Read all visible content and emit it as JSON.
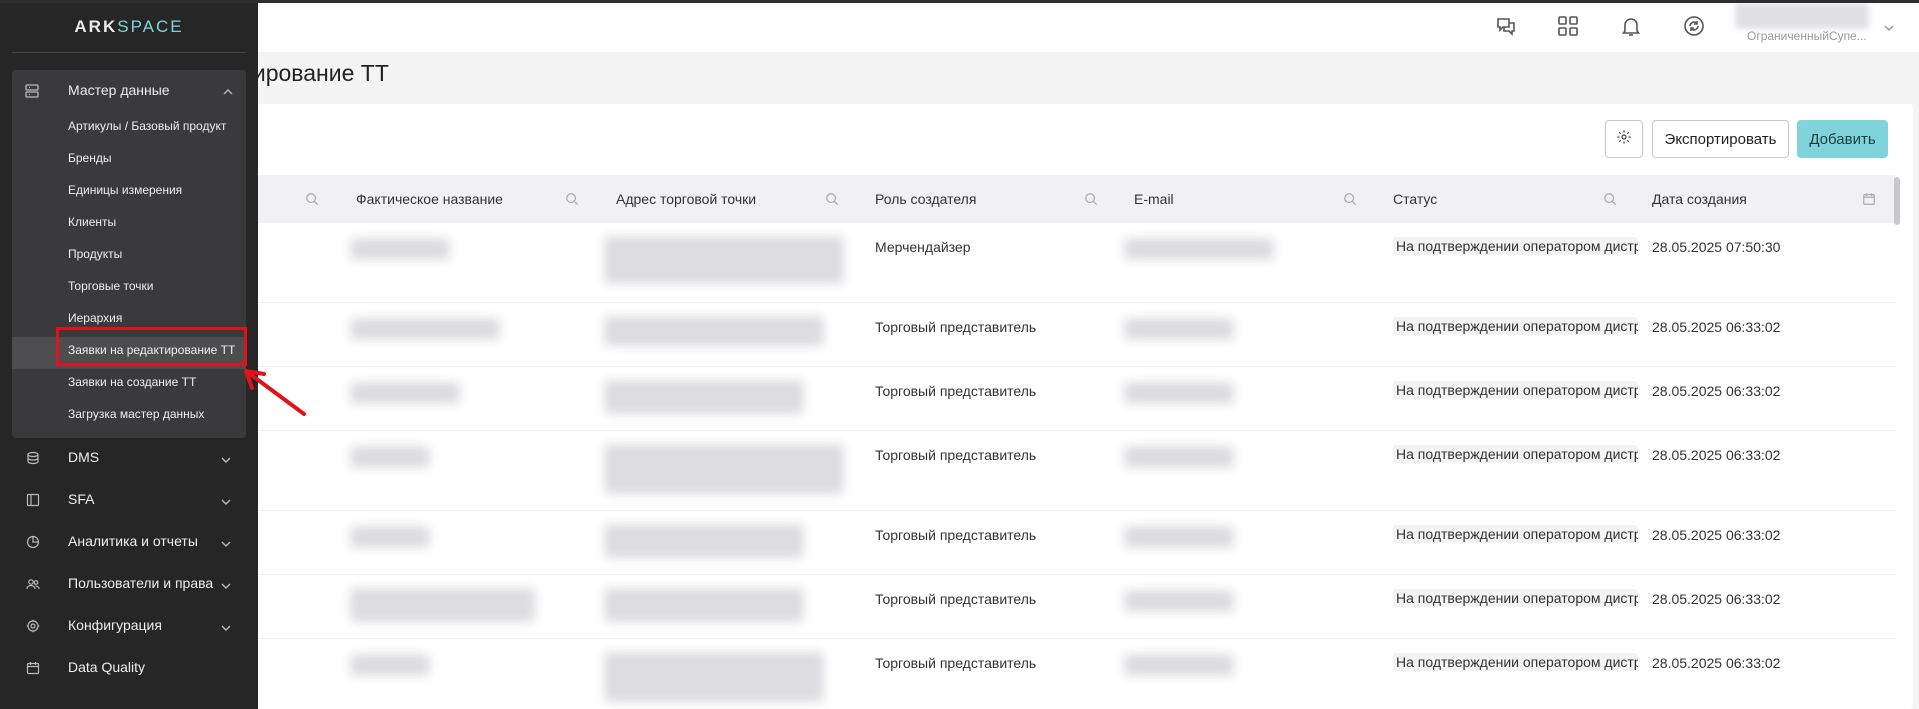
{
  "app": {
    "logo_text": "ARK",
    "logo_accent": "SPACE",
    "accent_color": "#7fd4dc"
  },
  "header": {
    "icons": [
      "chat-icon",
      "apps-grid-icon",
      "bell-icon",
      "sync-icon"
    ],
    "user_name": "ОграниченныйСупе...",
    "user_chevron": "⌄"
  },
  "page": {
    "title": "ктирование ТТ"
  },
  "toolbar": {
    "settings_icon": "gear-icon",
    "export_label": "Экспортировать",
    "add_label": "Добавить"
  },
  "sidebar": {
    "group": {
      "label": "Мастер данные",
      "items": [
        "Артикулы / Базовый продукт",
        "Бренды",
        "Единицы измерения",
        "Клиенты",
        "Продукты",
        "Торговые точки",
        "Иерархия",
        "Заявки на редактирование ТТ",
        "Заявки на создание ТТ",
        "Загрузка мастер данных"
      ],
      "active_item": "Заявки на редактирование ТТ"
    },
    "nav": [
      {
        "label": "DMS"
      },
      {
        "label": "SFA"
      },
      {
        "label": "Аналитика и отчеты"
      },
      {
        "label": "Пользователи и права"
      },
      {
        "label": "Конфигурация"
      },
      {
        "label": "Data Quality"
      }
    ]
  },
  "table": {
    "columns": [
      "Фактическое название",
      "Адрес торговой точки",
      "Роль создателя",
      "E-mail",
      "Статус",
      "Дата создания"
    ],
    "rows": [
      {
        "role": "Мерчендайзер",
        "status": "На подтверждении оператором дистрибьютора",
        "date": "28.05.2025 07:50:30"
      },
      {
        "role": "Торговый представитель",
        "status": "На подтверждении оператором дистрибьютора",
        "date": "28.05.2025 06:33:02"
      },
      {
        "role": "Торговый представитель",
        "status": "На подтверждении оператором дистрибьютора",
        "date": "28.05.2025 06:33:02"
      },
      {
        "role": "Торговый представитель",
        "status": "На подтверждении оператором дистрибьютора",
        "date": "28.05.2025 06:33:02"
      },
      {
        "role": "Торговый представитель",
        "status": "На подтверждении оператором дистрибьютора",
        "date": "28.05.2025 06:33:02"
      },
      {
        "role": "Торговый представитель",
        "status": "На подтверждении оператором дистрибьютора",
        "date": "28.05.2025 06:33:02"
      },
      {
        "role": "Торговый представитель",
        "status": "На подтверждении оператором дистрибьютора",
        "date": "28.05.2025 06:33:02"
      }
    ]
  }
}
